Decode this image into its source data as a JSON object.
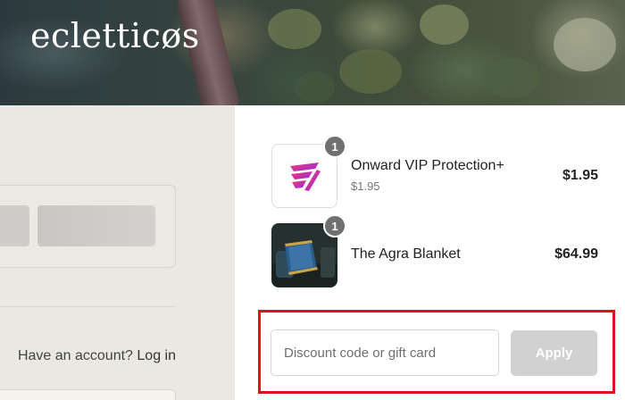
{
  "header": {
    "logo_text": "ecletticøs"
  },
  "left": {
    "account_prompt": "Have an account?",
    "login_link": "Log in"
  },
  "cart": {
    "items": [
      {
        "name": "Onward VIP Protection+",
        "subtitle": "$1.95",
        "price": "$1.95",
        "quantity": "1",
        "image_icon": "onward-logo-icon"
      },
      {
        "name": "The Agra Blanket",
        "price": "$64.99",
        "quantity": "1",
        "image_icon": "blanket-photo"
      }
    ]
  },
  "discount": {
    "placeholder": "Discount code or gift card",
    "apply_label": "Apply"
  },
  "colors": {
    "highlight_border": "#e01414",
    "left_panel_bg": "#eae8e3",
    "apply_disabled_bg": "#d1d1d1",
    "badge_bg": "#707070"
  }
}
